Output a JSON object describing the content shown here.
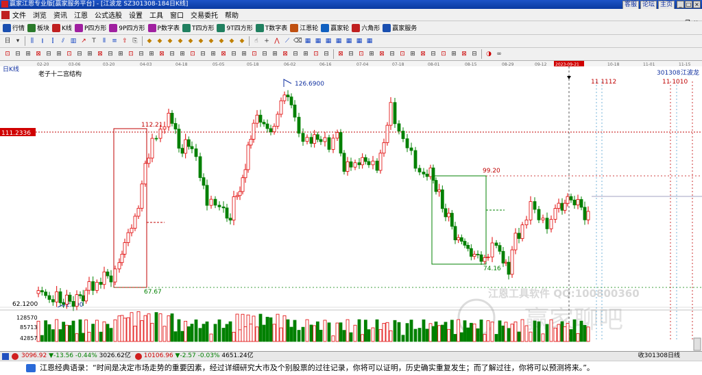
{
  "window": {
    "title": "赢家江恩专业版[赢家服务平台] - [江波龙  SZ301308-184日K线]",
    "links": [
      "客服",
      "论坛",
      "主页"
    ]
  },
  "menu": [
    "文件",
    "浏览",
    "资讯",
    "江恩",
    "公式选股",
    "设置",
    "工具",
    "窗口",
    "交易委托",
    "帮助"
  ],
  "toolbar1": [
    {
      "label": "行情",
      "icon": "quote-icon",
      "color": "#1a4fb0"
    },
    {
      "label": "板块",
      "icon": "sector-icon",
      "color": "#2a7a2a"
    },
    {
      "label": "K线",
      "icon": "kline-icon",
      "color": "#c02020"
    },
    {
      "label": "P四方形",
      "icon": "p-square-icon",
      "color": "#a020a0"
    },
    {
      "label": "9P四方形",
      "icon": "9p-square-icon",
      "color": "#a020a0"
    },
    {
      "label": "P数字表",
      "icon": "p-number-table-icon",
      "color": "#a020a0"
    },
    {
      "label": "T四方形",
      "icon": "t-square-icon",
      "color": "#208060"
    },
    {
      "label": "9T四方形",
      "icon": "9t-square-icon",
      "color": "#208060"
    },
    {
      "label": "T数字表",
      "icon": "t-number-table-icon",
      "color": "#208060"
    },
    {
      "label": "江恩轮",
      "icon": "gann-wheel-icon",
      "color": "#c05010"
    },
    {
      "label": "赢家轮",
      "icon": "winner-wheel-icon",
      "color": "#1060c0"
    },
    {
      "label": "六角形",
      "icon": "hexagon-icon",
      "color": "#c02020"
    },
    {
      "label": "赢家服务",
      "icon": "service-icon",
      "color": "#1a4fb0"
    }
  ],
  "chart": {
    "period_label": "日K线",
    "indicator_label": "老子十二宫结构",
    "stock_code": "301308",
    "stock_name": "江波龙",
    "current_price_tag": "111.2336",
    "y_axis_low": "62.1200",
    "volume_ticks": [
      "128570",
      "85713",
      "42857"
    ],
    "date_ticks": [
      "02-20",
      "03-06",
      "03-20",
      "04-03",
      "04-18",
      "05-05",
      "05-18",
      "06-02",
      "06-16",
      "07-04",
      "07-18",
      "08-01",
      "08-15",
      "08-29",
      "09-12",
      "2023-09-21",
      "10-18",
      "11-01",
      "11-15"
    ],
    "annotations": {
      "high": "126.6900",
      "box1_top": "112.21",
      "box1_bottom": "67.67",
      "box2_top": "99.20",
      "box2_bottom": "74.16",
      "low": "52.300",
      "future_cycles_left": "11 1112",
      "future_cycles_right": "11 1010"
    },
    "watermark": {
      "tool_text": "江恩工具软件  QQ:100800360",
      "brand_text": "赢家聊吧"
    },
    "colors": {
      "up": "#e00000",
      "down": "#008000",
      "box": "#c00000",
      "box2": "#008000"
    }
  },
  "statusbar": {
    "sh_index": "3096.92",
    "sh_change": "▼-13.56",
    "sh_pct": "-0.44%",
    "sh_amount": "3026.62亿",
    "sz_index": "10106.96",
    "sz_change": "▼-2.57",
    "sz_pct": "-0.03%",
    "sz_amount": "4651.24亿",
    "right_text": "收301308日线"
  },
  "quote": {
    "text": "江恩经典语录：“时间是决定市场走势的重要因素，经过详细研究大市及个别股票的过往记录，你将可以证明，历史确实重复发生；而了解过往，你将可以预测将来。”。"
  }
}
